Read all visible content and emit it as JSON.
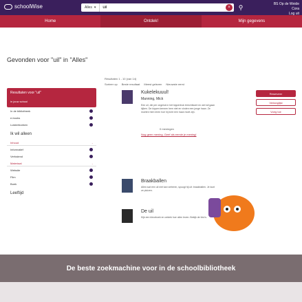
{
  "header": {
    "brand": "schoolWise",
    "scope_label": "Alles",
    "search_value": "uil",
    "right_line1": "BS Op de Weide",
    "right_line2": "Cora",
    "right_line3": "Log uit"
  },
  "nav": {
    "home": "Home",
    "discover": "Ontdek!",
    "my_data": "Mijn gegevens"
  },
  "results_heading": "Gevonden voor \"uil\" in \"Alles\"",
  "sidebar": {
    "heading": "Resultaten voor \"uil\"",
    "subheading": "in jouw school",
    "rows_top": [
      "In de bibliotheek",
      "e-books",
      "Luisterboeken"
    ],
    "i_want_label": "Ik wil alleen",
    "filter1": "Inhoud",
    "rows_mid": [
      "Informatief",
      "Verhalend"
    ],
    "filter2": "Materiaal",
    "rows_bottom": [
      "Website",
      "Film",
      "Boek"
    ],
    "last_label": "Leeftijd"
  },
  "main": {
    "results_count": "Resultaten 1 - 10 (van 14)",
    "sort_label": "Sorteer op",
    "sort_options": [
      "Beste resultaat",
      "Meest gelezen",
      "Nieuwste eerst"
    ],
    "results": [
      {
        "title": "Kukelekuuul!",
        "author": "Manning, Mick",
        "desc": "Een uil, die per ongeluk in het kippenhok terechtkomt en wel wil gaan kijken. De kippen kennen hem niet en vinden een jonge haan. Ze moeten hem leren hoe hij echt een haan moet zijn.",
        "reserve": "Reserveer",
        "wishlist": "Verlanglijst",
        "add": "Voeg toe",
        "rating": "0 meningen",
        "link": "Nog geen mening. Geef als eerste je mening!"
      },
      {
        "title": "Braakballen",
        "author": "",
        "desc": "Alles wat een uil niet kan verteren, spuugt hij uit: braakballen. Je kunt ze pluizen.",
        "reserve": "",
        "wishlist": "",
        "add": "",
        "rating": "",
        "link": ""
      },
      {
        "title": "De uil",
        "author": "",
        "desc": "Kijk een kleurboek en ontdek hoe uilen leven. Bekijk de foto's.",
        "reserve": "",
        "wishlist": "",
        "add": "",
        "rating": "",
        "link": ""
      }
    ]
  },
  "banner_text": "De beste zoekmachine voor in de schoolbibliotheek",
  "colors": {
    "top": "#3a1f5c",
    "accent": "#b5263f",
    "banner": "#7a6d70"
  }
}
